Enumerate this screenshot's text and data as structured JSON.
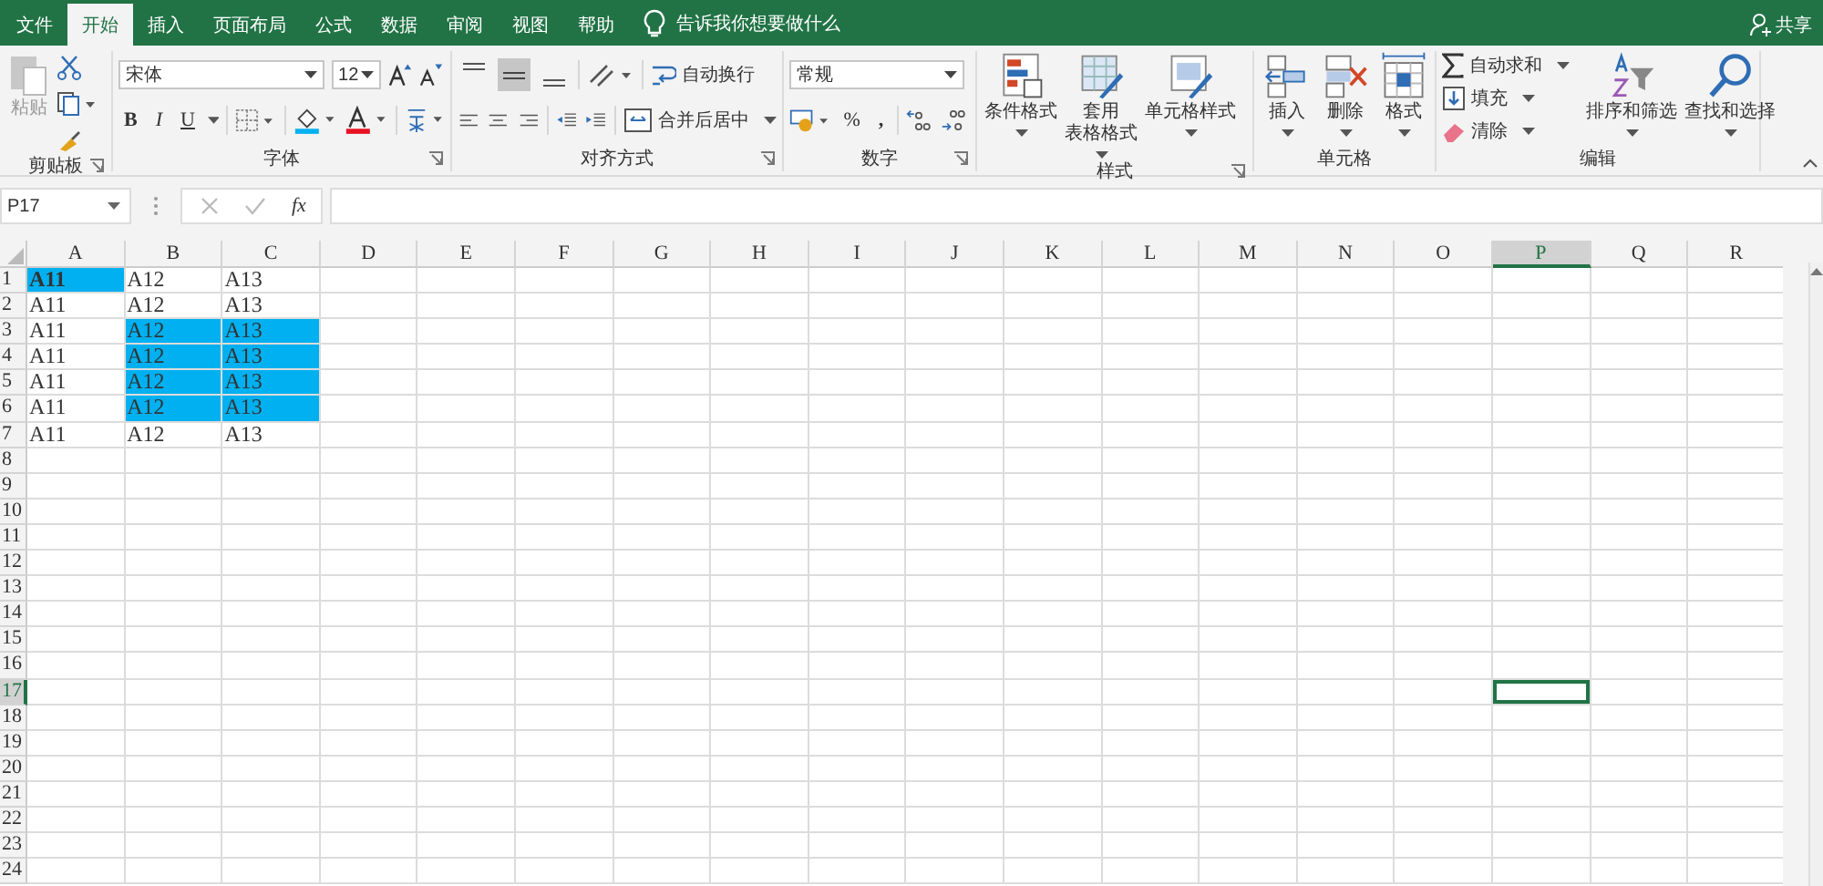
{
  "ribbon_tabs": [
    {
      "label": "文件",
      "selected": false
    },
    {
      "label": "开始",
      "selected": true
    },
    {
      "label": "插入",
      "selected": false
    },
    {
      "label": "页面布局",
      "selected": false
    },
    {
      "label": "公式",
      "selected": false
    },
    {
      "label": "数据",
      "selected": false
    },
    {
      "label": "审阅",
      "selected": false
    },
    {
      "label": "视图",
      "selected": false
    },
    {
      "label": "帮助",
      "selected": false
    }
  ],
  "tell_me": "告诉我你想要做什么",
  "share": "共享",
  "ribbon": {
    "clipboard": {
      "label": "剪贴板",
      "paste": "粘贴"
    },
    "font": {
      "label": "字体",
      "font_name": "宋体",
      "font_size": "12",
      "bold": "B",
      "italic": "I",
      "underline": "U"
    },
    "alignment": {
      "label": "对齐方式",
      "wrap_text": "自动换行",
      "merge": "合并后居中"
    },
    "number": {
      "label": "数字",
      "format": "常规",
      "percent": "%",
      "comma": ","
    },
    "styles": {
      "label": "样式",
      "buttons": [
        {
          "lines": [
            "条件格式"
          ]
        },
        {
          "lines": [
            "套用",
            "表格格式"
          ]
        },
        {
          "lines": [
            "单元格样式"
          ]
        }
      ]
    },
    "cells": {
      "label": "单元格",
      "buttons": [
        "插入",
        "删除",
        "格式"
      ]
    },
    "editing": {
      "label": "编辑",
      "autosum": "自动求和",
      "fill": "填充",
      "clear": "清除",
      "sort_filter": "排序和筛选",
      "find_select": "查找和选择"
    }
  },
  "formula_bar": {
    "name_box": "P17",
    "function_label": "fx"
  },
  "sheet": {
    "columns": [
      {
        "label": "A",
        "selected": false
      },
      {
        "label": "B",
        "selected": false
      },
      {
        "label": "C",
        "selected": false
      },
      {
        "label": "D",
        "selected": false
      },
      {
        "label": "E",
        "selected": false
      },
      {
        "label": "F",
        "selected": false
      },
      {
        "label": "G",
        "selected": false
      },
      {
        "label": "H",
        "selected": false
      },
      {
        "label": "I",
        "selected": false
      },
      {
        "label": "J",
        "selected": false
      },
      {
        "label": "K",
        "selected": false
      },
      {
        "label": "L",
        "selected": false
      },
      {
        "label": "M",
        "selected": false
      },
      {
        "label": "N",
        "selected": false
      },
      {
        "label": "O",
        "selected": false
      },
      {
        "label": "P",
        "selected": true
      },
      {
        "label": "Q",
        "selected": false
      },
      {
        "label": "R",
        "selected": false
      }
    ],
    "rows": [
      {
        "label": "1",
        "selected": false,
        "cells": [
          {
            "text": "A11",
            "bold": true,
            "highlighted": true
          },
          {
            "text": "A12",
            "bold": false,
            "highlighted": false
          },
          {
            "text": "A13",
            "bold": false,
            "highlighted": false
          }
        ]
      },
      {
        "label": "2",
        "selected": false,
        "cells": [
          {
            "text": "A11",
            "bold": false,
            "highlighted": false
          },
          {
            "text": "A12",
            "bold": false,
            "highlighted": false
          },
          {
            "text": "A13",
            "bold": false,
            "highlighted": false
          }
        ]
      },
      {
        "label": "3",
        "selected": false,
        "cells": [
          {
            "text": "A11",
            "bold": false,
            "highlighted": false
          },
          {
            "text": "A12",
            "bold": false,
            "highlighted": true
          },
          {
            "text": "A13",
            "bold": false,
            "highlighted": true
          }
        ]
      },
      {
        "label": "4",
        "selected": false,
        "cells": [
          {
            "text": "A11",
            "bold": false,
            "highlighted": false
          },
          {
            "text": "A12",
            "bold": false,
            "highlighted": true
          },
          {
            "text": "A13",
            "bold": false,
            "highlighted": true
          }
        ]
      },
      {
        "label": "5",
        "selected": false,
        "cells": [
          {
            "text": "A11",
            "bold": false,
            "highlighted": false
          },
          {
            "text": "A12",
            "bold": false,
            "highlighted": true
          },
          {
            "text": "A13",
            "bold": false,
            "highlighted": true
          }
        ]
      },
      {
        "label": "6",
        "selected": false,
        "cells": [
          {
            "text": "A11",
            "bold": false,
            "highlighted": false
          },
          {
            "text": "A12",
            "bold": false,
            "highlighted": true
          },
          {
            "text": "A13",
            "bold": false,
            "highlighted": true
          }
        ]
      },
      {
        "label": "7",
        "selected": false,
        "cells": [
          {
            "text": "A11",
            "bold": false,
            "highlighted": false
          },
          {
            "text": "A12",
            "bold": false,
            "highlighted": false
          },
          {
            "text": "A13",
            "bold": false,
            "highlighted": false
          }
        ]
      },
      {
        "label": "8",
        "selected": false
      },
      {
        "label": "9",
        "selected": false
      },
      {
        "label": "10",
        "selected": false
      },
      {
        "label": "11",
        "selected": false
      },
      {
        "label": "12",
        "selected": false
      },
      {
        "label": "13",
        "selected": false
      },
      {
        "label": "14",
        "selected": false
      },
      {
        "label": "15",
        "selected": false
      },
      {
        "label": "16",
        "selected": false
      },
      {
        "label": "17",
        "selected": true
      },
      {
        "label": "18",
        "selected": false
      },
      {
        "label": "19",
        "selected": false
      },
      {
        "label": "20",
        "selected": false
      },
      {
        "label": "21",
        "selected": false
      },
      {
        "label": "22",
        "selected": false
      },
      {
        "label": "23",
        "selected": false
      },
      {
        "label": "24",
        "selected": false
      }
    ]
  }
}
